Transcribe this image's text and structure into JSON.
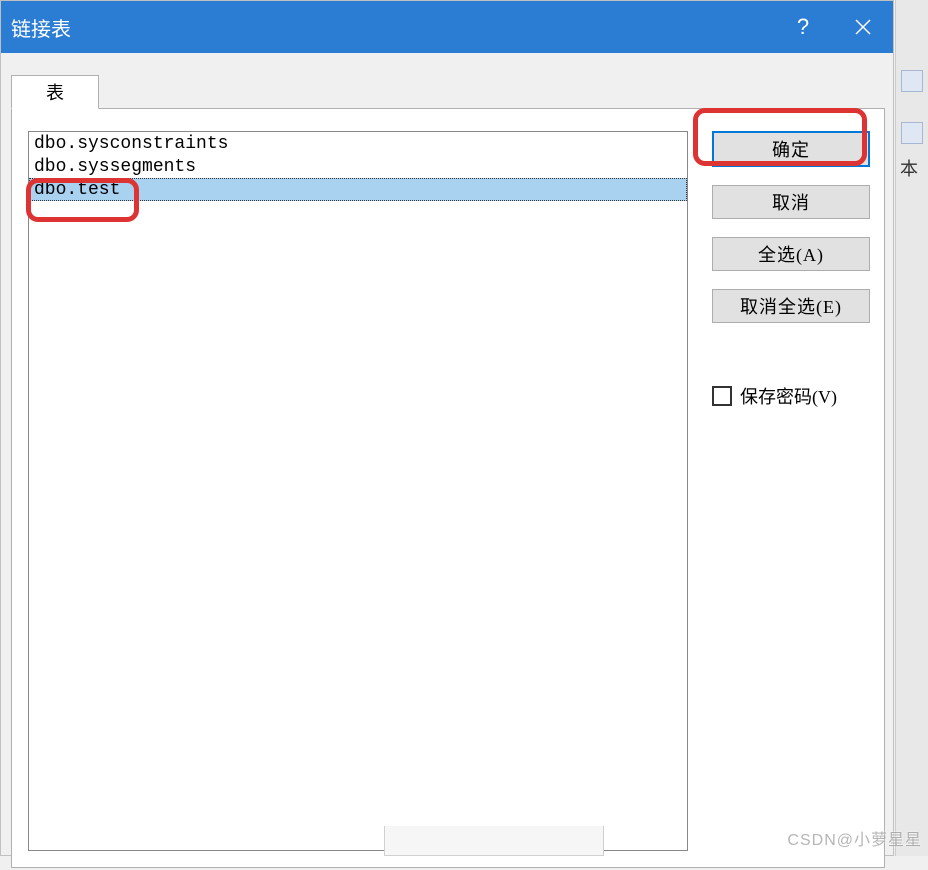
{
  "dialog": {
    "title": "链接表",
    "help_symbol": "?",
    "tab_label": "表"
  },
  "list": {
    "items": [
      {
        "label": "dbo.sysconstraints",
        "selected": false
      },
      {
        "label": "dbo.syssegments",
        "selected": false
      },
      {
        "label": "dbo.test",
        "selected": true
      }
    ]
  },
  "buttons": {
    "ok": "确定",
    "cancel": "取消",
    "select_all": "全选(A)",
    "deselect_all": "取消全选(E)"
  },
  "checkbox": {
    "save_password": "保存密码(V)",
    "checked": false
  },
  "right_hint": "本",
  "watermark": "CSDN@小萝星星"
}
